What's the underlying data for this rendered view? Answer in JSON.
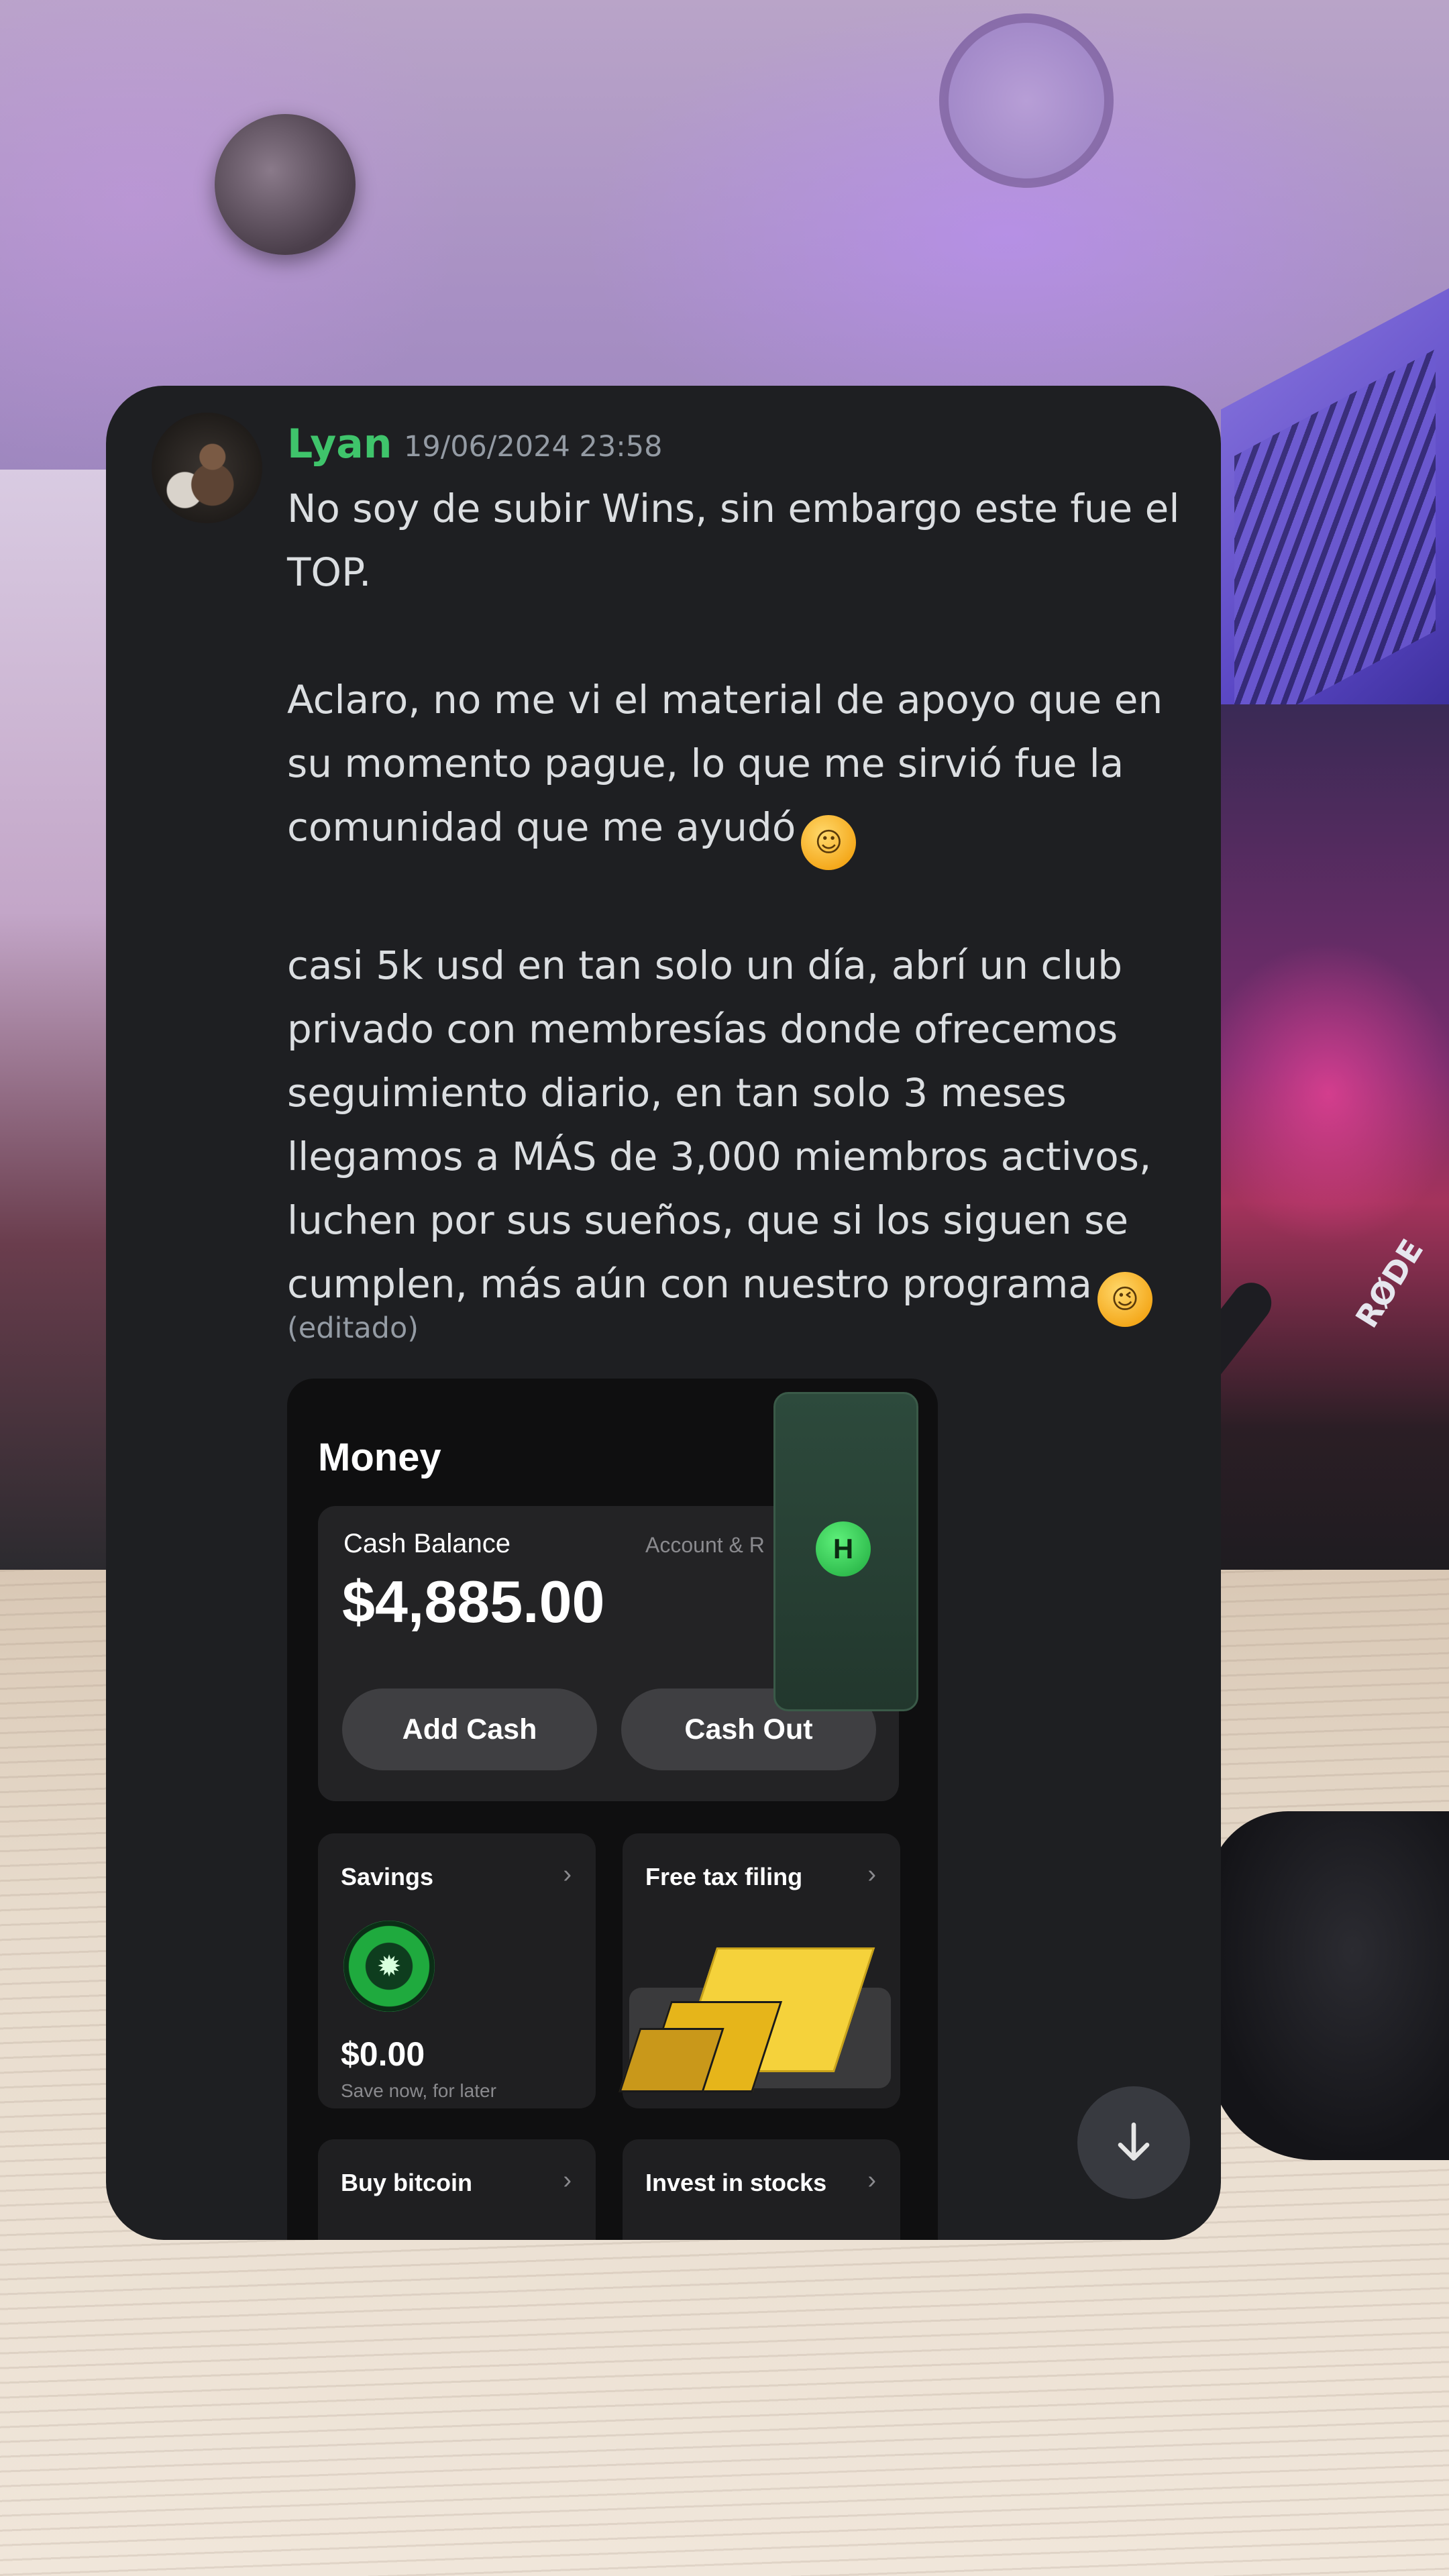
{
  "message": {
    "author": "Lyan",
    "timestamp": "19/06/2024 23:58",
    "text_lines": [
      "No soy de subir Wins, sin embargo este fue el",
      "TOP.",
      "",
      "Aclaro, no me vi el material de apoyo que en",
      "su momento pague, lo que me sirvió fue la",
      "comunidad que me ayudó"
    ],
    "text_lines_2": [
      "",
      "casi 5k usd en tan solo un día, abrí un club",
      "privado con membresías donde ofrecemos",
      "seguimiento diario, en tan solo 3 meses",
      "llegamos a MÁS de 3,000 miembros activos,",
      "luchen por sus sueños, que si los siguen se",
      "cumplen, más aún con nuestro programa"
    ],
    "emoji_1": "saluting-face-emoji",
    "emoji_2": "winking-face-emoji",
    "edited_label": "(editado)"
  },
  "attachment": {
    "title": "Money",
    "cash_balance_label": "Cash Balance",
    "account_label": "Account & R",
    "cash_balance_value": "$4,885.00",
    "add_cash": "Add Cash",
    "cash_out": "Cash Out",
    "overlay_badge": "H",
    "tiles": {
      "savings": {
        "label": "Savings",
        "value": "$0.00",
        "sub": "Save now, for later"
      },
      "tax": {
        "label": "Free tax filing"
      },
      "bitcoin": {
        "label": "Buy bitcoin"
      },
      "stocks": {
        "label": "Invest in stocks"
      }
    },
    "chevron": "›"
  },
  "background": {
    "brand_text": "RØDE"
  },
  "colors": {
    "card_bg": "#1e1f22",
    "author": "#3fc46b",
    "muted": "#949ba4",
    "text": "#dbdee1"
  }
}
